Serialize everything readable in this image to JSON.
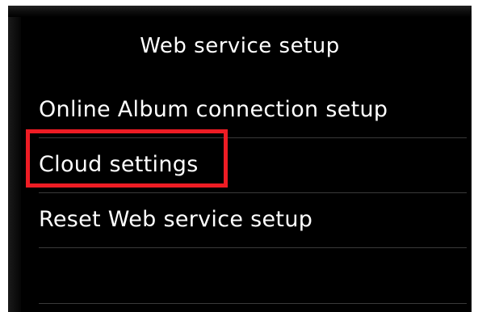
{
  "screen": {
    "title": "Web service setup",
    "menu_items": [
      {
        "label": "Online Album connection setup"
      },
      {
        "label": "Cloud settings",
        "highlighted": true
      },
      {
        "label": "Reset Web service setup"
      },
      {
        "label": ""
      }
    ]
  },
  "colors": {
    "background": "#000000",
    "text": "#ffffff",
    "highlight_border": "#ee1c24"
  }
}
